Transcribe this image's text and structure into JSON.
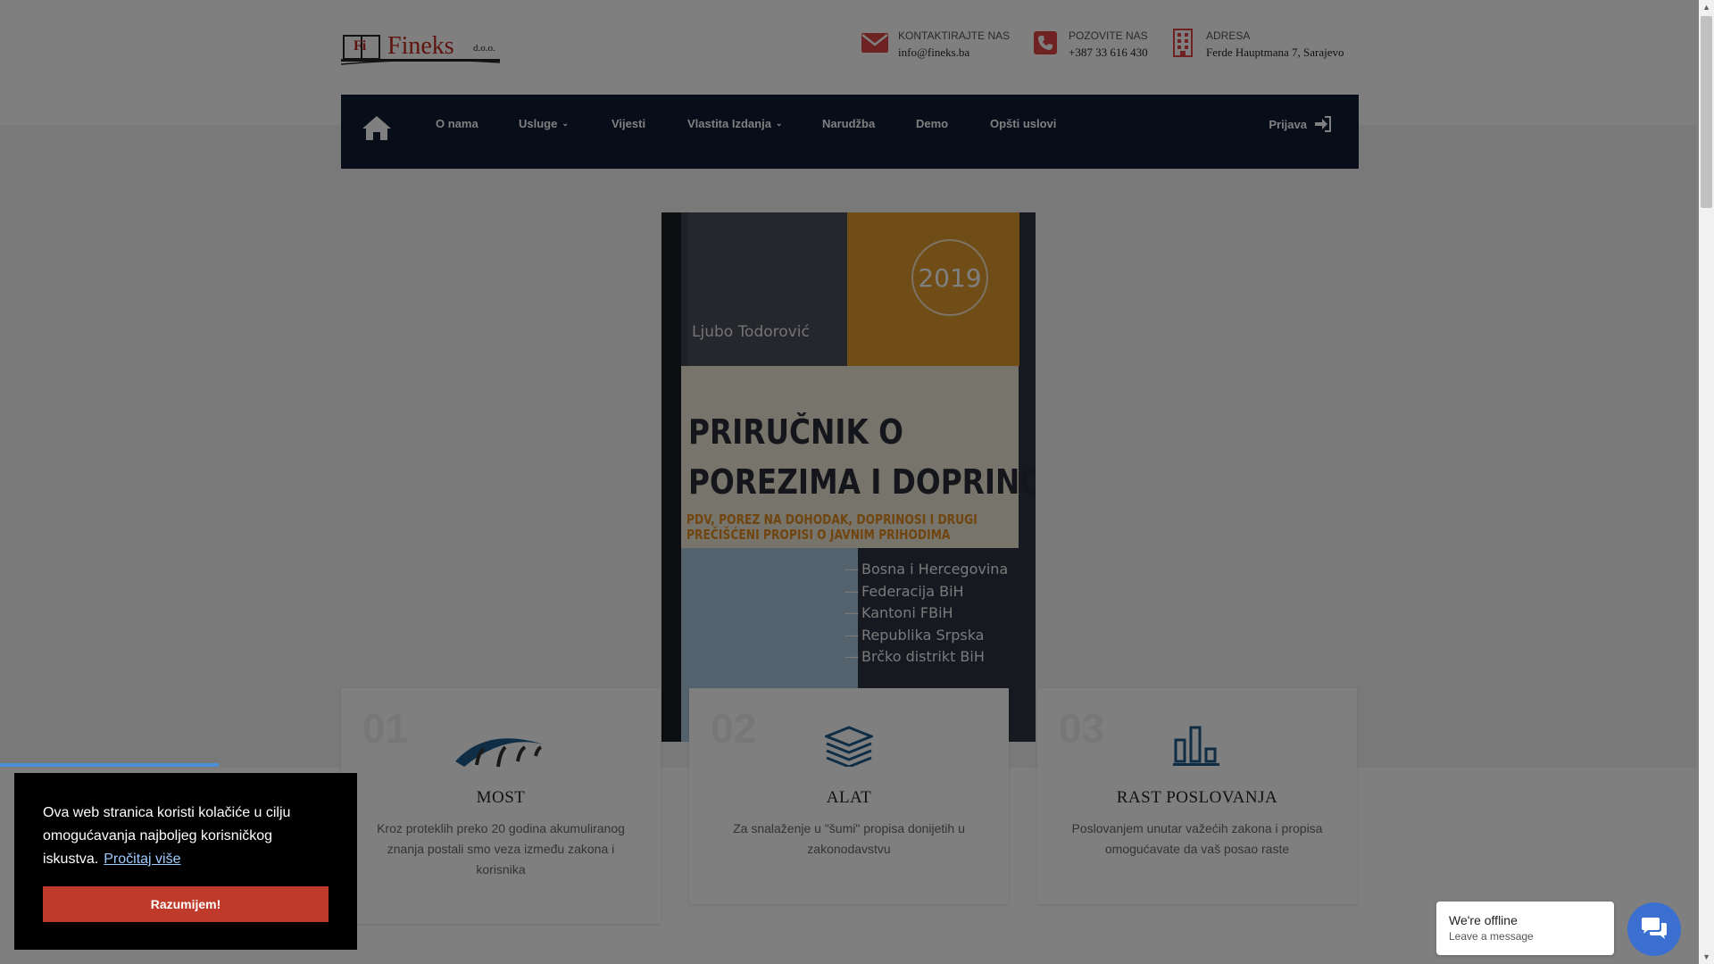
{
  "header": {
    "logo": {
      "brand": "Fineks",
      "suffix": "d.o.o.",
      "mark": "Fi"
    },
    "contacts": [
      {
        "label": "KONTAKTIRAJTE NAS",
        "value": "info@fineks.ba",
        "icon": "envelope-icon"
      },
      {
        "label": "POZOVITE NAS",
        "value": "+387 33 616 430",
        "icon": "phone-icon"
      },
      {
        "label": "ADRESA",
        "value": "Ferde Hauptmana 7, Sarajevo",
        "icon": "building-icon"
      }
    ]
  },
  "nav": {
    "home_icon": "home-icon",
    "items": [
      {
        "label": "O nama",
        "dropdown": false
      },
      {
        "label": "Usluge",
        "dropdown": true
      },
      {
        "label": "Vijesti",
        "dropdown": false
      },
      {
        "label": "Vlastita Izdanja",
        "dropdown": true
      },
      {
        "label": "Narudžba",
        "dropdown": false
      },
      {
        "label": "Demo",
        "dropdown": false
      },
      {
        "label": "Opšti uslovi",
        "dropdown": false
      }
    ],
    "login": {
      "label": "Prijava",
      "icon": "sign-in-icon"
    }
  },
  "book": {
    "year": "2019",
    "author": "Ljubo Todorović",
    "title_line1": "PRIRUČNIK O",
    "title_line2": "POREZIMA I DOPRINOSIMA",
    "subtitle_line1": "PDV, POREZ NA DOHODAK, DOPRINOSI I DRUGI",
    "subtitle_line2": "PREČIŠĆENI PROPISI O JAVNIM PRIHODIMA",
    "regions": [
      "Bosna i Hercegovina",
      "Federacija BiH",
      "Kantoni FBiH",
      "Republika Srpska",
      "Brčko distrikt BiH"
    ]
  },
  "features": [
    {
      "num": "01",
      "title": "MOST",
      "text": "Kroz proteklih preko 20 godina akumuliranog znanja postali smo veza između zakona i korisnika",
      "icon": "bridge-icon"
    },
    {
      "num": "02",
      "title": "ALAT",
      "text": "Za snalaženje u \"šumi\" propisa donijetih u zakonodavstvu",
      "icon": "layers-icon"
    },
    {
      "num": "03",
      "title": "RAST POSLOVANJA",
      "text": "Poslovanjem unutar važećih zakona i propisa omogućavate da vaš posao raste",
      "icon": "bar-chart-icon"
    }
  ],
  "cookie": {
    "message": "Ova web stranica koristi kolačiće u cilju omogućavanja najboljeg korisničkog iskustva.",
    "more_link": "Pročitaj više",
    "accept_button": "Razumijem!"
  },
  "chat": {
    "status": "We're offline",
    "prompt": "Leave a message",
    "icon": "chat-bubbles-icon"
  },
  "colors": {
    "nav_bg": "#0e1a33",
    "accent_blue": "#1f5d8c",
    "cookie_button": "#c03a2b",
    "chat_button": "#3b6fd0"
  }
}
